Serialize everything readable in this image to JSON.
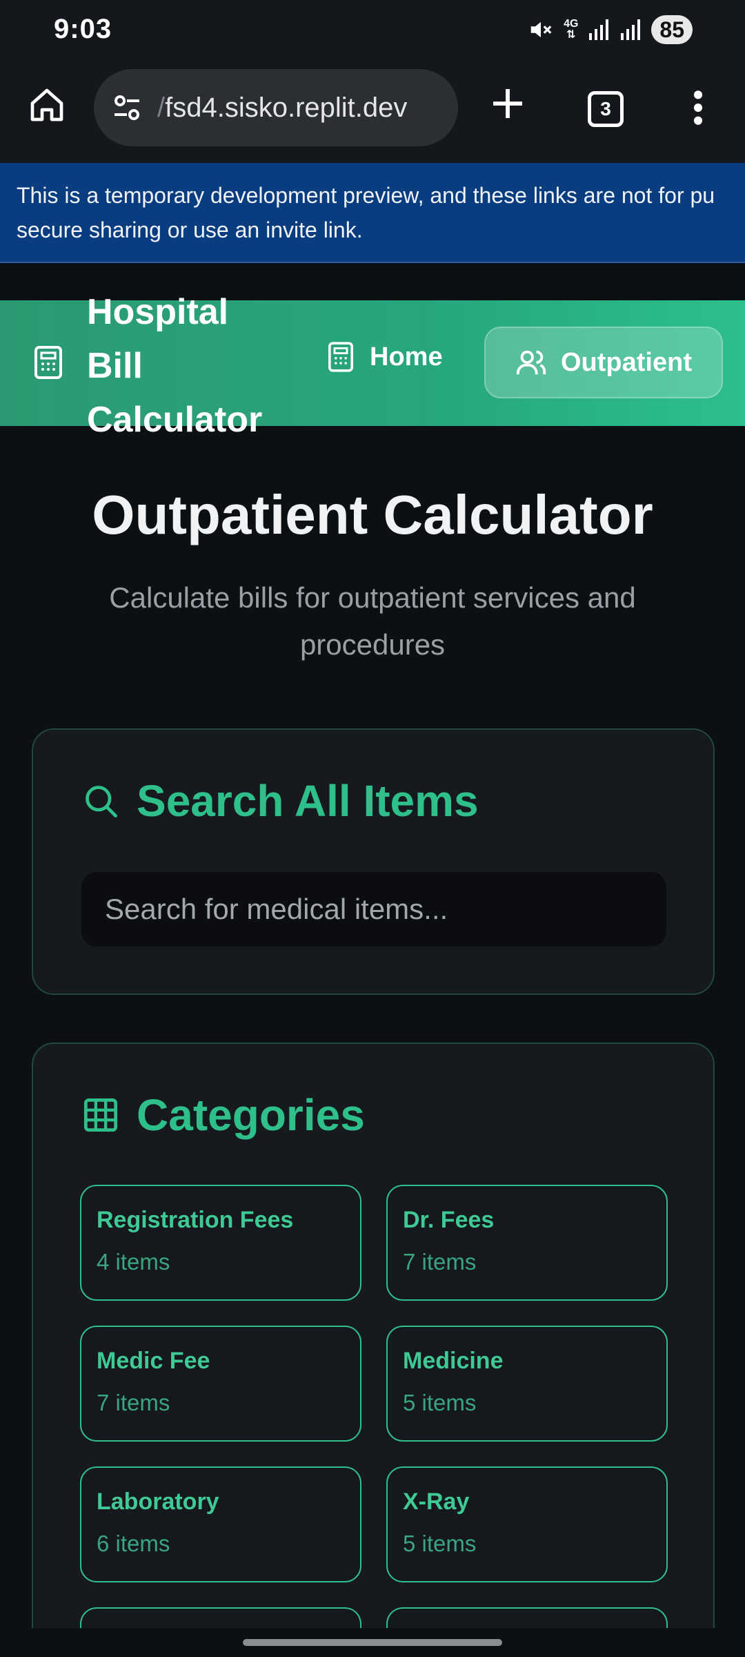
{
  "status_bar": {
    "time": "9:03",
    "network_label": "4G",
    "battery": "85"
  },
  "browser": {
    "url_faded": "/",
    "url": "fsd4.sisko.replit.dev",
    "tab_count": "3"
  },
  "dev_banner": {
    "line1": "This is a temporary development preview, and these links are not for pu",
    "line2": "secure sharing or use an invite link."
  },
  "header": {
    "brand_line1": "Hospital",
    "brand_line2": "Bill",
    "brand_line3": "Calculator",
    "nav_home": "Home",
    "nav_outpatient": "Outpatient"
  },
  "page": {
    "title": "Outpatient Calculator",
    "subtitle": "Calculate bills for outpatient services and procedures"
  },
  "search": {
    "heading": "Search All Items",
    "placeholder": "Search for medical items..."
  },
  "categories": {
    "heading": "Categories",
    "items": [
      {
        "name": "Registration Fees",
        "count": "4 items"
      },
      {
        "name": "Dr. Fees",
        "count": "7 items"
      },
      {
        "name": "Medic Fee",
        "count": "7 items"
      },
      {
        "name": "Medicine",
        "count": "5 items"
      },
      {
        "name": "Laboratory",
        "count": "6 items"
      },
      {
        "name": "X-Ray",
        "count": "5 items"
      }
    ]
  },
  "colors": {
    "accent": "#2fbf8a",
    "header_gradient_start": "#2b9a72",
    "banner": "#0a3d80",
    "background": "#0d1013"
  }
}
